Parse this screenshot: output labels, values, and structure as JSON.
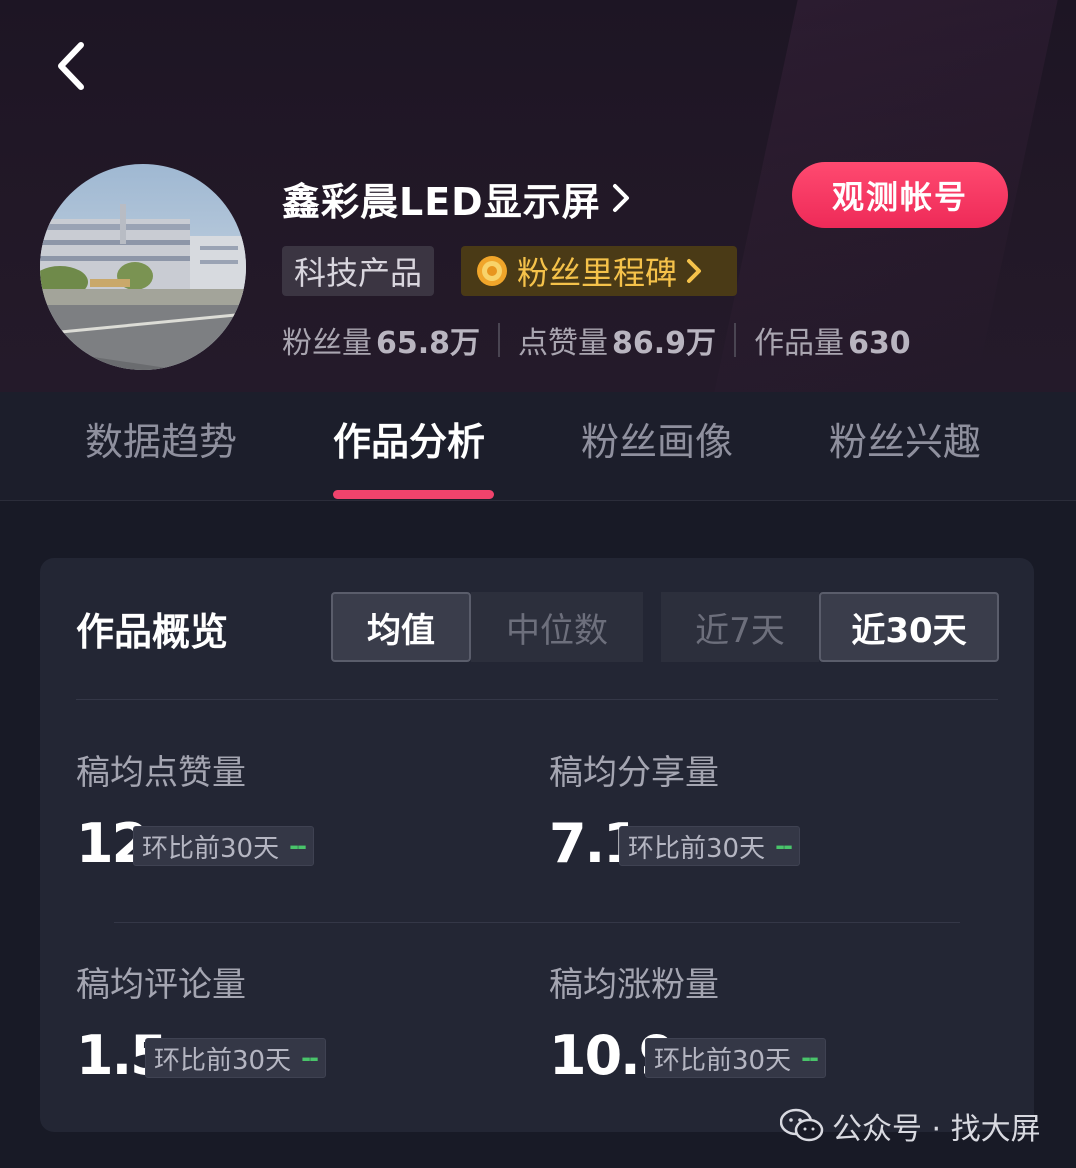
{
  "header": {
    "account_name": "鑫彩晨LED显示屏",
    "observe_button": "观测帐号",
    "category_tag": "科技产品",
    "milestone_tag": "粉丝里程碑",
    "stats": [
      {
        "label": "粉丝量",
        "value": "65.8万"
      },
      {
        "label": "点赞量",
        "value": "86.9万"
      },
      {
        "label": "作品量",
        "value": "630"
      }
    ]
  },
  "tabs": [
    {
      "label": "数据趋势",
      "active": false
    },
    {
      "label": "作品分析",
      "active": true
    },
    {
      "label": "粉丝画像",
      "active": false
    },
    {
      "label": "粉丝兴趣",
      "active": false
    }
  ],
  "overview": {
    "title": "作品概览",
    "stat_toggle": [
      {
        "label": "均值",
        "active": true
      },
      {
        "label": "中位数",
        "active": false
      }
    ],
    "period_toggle": [
      {
        "label": "近7天",
        "active": false
      },
      {
        "label": "近30天",
        "active": true
      }
    ],
    "metrics": [
      {
        "label": "稿均点赞量",
        "value": "12",
        "compare_label": "环比前30天",
        "compare_value": "--"
      },
      {
        "label": "稿均分享量",
        "value": "7.1",
        "compare_label": "环比前30天",
        "compare_value": "--"
      },
      {
        "label": "稿均评论量",
        "value": "1.5",
        "compare_label": "环比前30天",
        "compare_value": "--"
      },
      {
        "label": "稿均涨粉量",
        "value": "10.9",
        "compare_label": "环比前30天",
        "compare_value": "--"
      }
    ]
  },
  "watermark": {
    "text": "公众号 · 找大屏",
    "icon": "wechat-icon"
  },
  "colors": {
    "accent": "#f0436c",
    "milestone": "#f5c24a",
    "compare_neutral": "#49c46a"
  }
}
